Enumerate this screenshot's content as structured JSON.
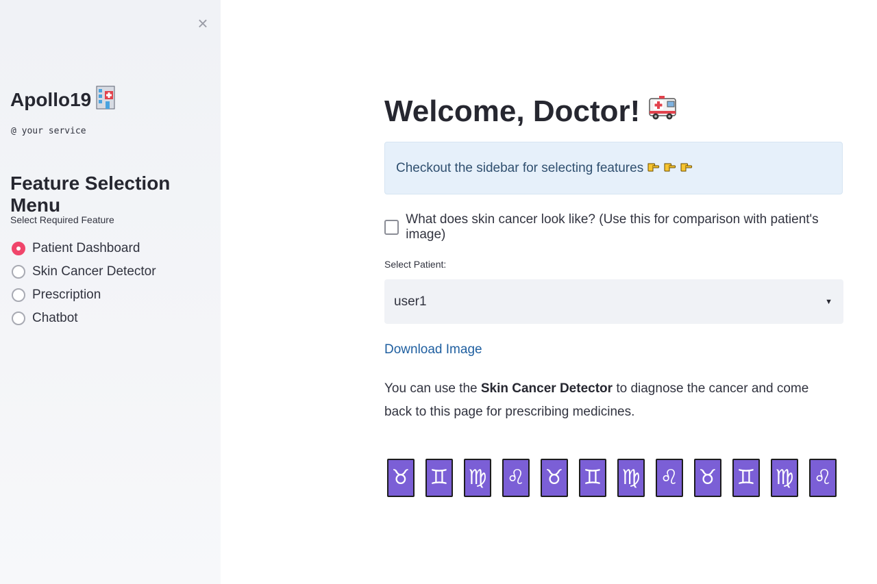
{
  "sidebar": {
    "close_glyph": "×",
    "brand_name": "Apollo19",
    "brand_icon": "hospital-icon",
    "tagline": "@ your service",
    "menu_title": "Feature Selection Menu",
    "radio_label": "Select Required Feature",
    "selected": "Patient Dashboard",
    "options": [
      {
        "label": "Patient Dashboard"
      },
      {
        "label": "Skin Cancer Detector"
      },
      {
        "label": "Prescription"
      },
      {
        "label": "Chatbot"
      }
    ]
  },
  "main": {
    "title": "Welcome, Doctor!",
    "title_icon": "ambulance-icon",
    "info_text": "Checkout the sidebar for selecting features",
    "info_icons": [
      "pointing-hand-icon",
      "pointing-hand-icon",
      "pointing-hand-icon"
    ],
    "checkbox_label": "What does skin cancer look like? (Use this for comparison with patient's image)",
    "checkbox_checked": false,
    "select_label": "Select Patient:",
    "select_value": "user1",
    "download_link": "Download Image",
    "para_before": "You can use the ",
    "para_bold": "Skin Cancer Detector",
    "para_after": " to diagnose the cancer and come back to this page for prescribing medicines.",
    "zodiac_glyphs": [
      "♉",
      "♊",
      "♍",
      "♌",
      "♉",
      "♊",
      "♍",
      "♌",
      "♉",
      "♊",
      "♍",
      "♌"
    ]
  },
  "colors": {
    "accent": "#f0456b",
    "sidebar_bg": "#f0f2f6",
    "info_bg": "#e6f0fa",
    "link": "#1f5fa0",
    "zodiac_bg": "#7b5fd6"
  }
}
